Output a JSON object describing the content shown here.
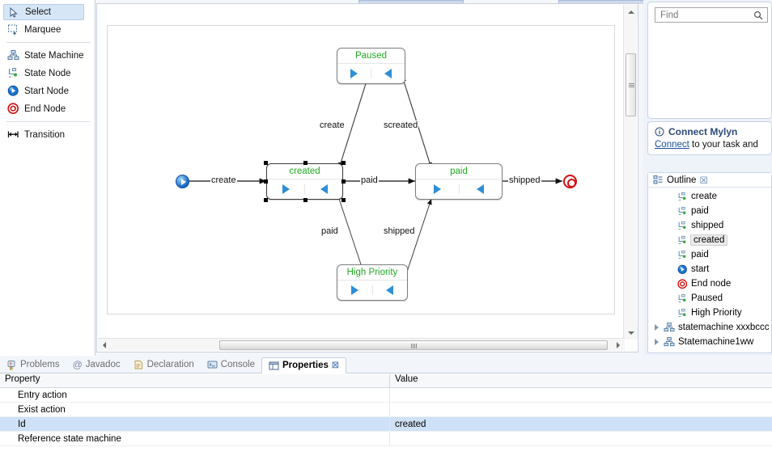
{
  "palette": {
    "groups": [
      {
        "items": [
          {
            "label": "Select",
            "icon": "cursor-icon",
            "selected": true
          },
          {
            "label": "Marquee",
            "icon": "marquee-icon",
            "selected": false
          }
        ]
      },
      {
        "items": [
          {
            "label": "State Machine",
            "icon": "state-machine-icon",
            "selected": false
          },
          {
            "label": "State Node",
            "icon": "state-node-icon",
            "selected": false
          },
          {
            "label": "Start Node",
            "icon": "start-node-icon",
            "selected": false
          },
          {
            "label": "End Node",
            "icon": "end-node-icon",
            "selected": false
          }
        ]
      },
      {
        "items": [
          {
            "label": "Transition",
            "icon": "transition-icon",
            "selected": false
          }
        ]
      }
    ]
  },
  "diagram": {
    "nodes": [
      {
        "id": "paused",
        "label": "Paused",
        "selected": false
      },
      {
        "id": "created",
        "label": "created",
        "selected": true
      },
      {
        "id": "paid",
        "label": "paid",
        "selected": false
      },
      {
        "id": "high_priority",
        "label": "High Priority",
        "selected": false
      }
    ],
    "start_node": "start-node-icon",
    "end_node": "end-node-icon",
    "edge_labels": {
      "start_to_created": "create",
      "created_to_paused": "create",
      "paused_to_paid": "screated",
      "created_to_paid": "paid",
      "paid_to_end": "shipped",
      "created_to_high": "paid",
      "high_to_paid": "shipped"
    }
  },
  "find": {
    "placeholder": "Find",
    "value": "",
    "icon": "search-icon"
  },
  "mylyn": {
    "icon": "info-icon",
    "title": "Connect Mylyn",
    "link_text": "Connect",
    "rest_text": " to your task and"
  },
  "outline": {
    "tab_label": "Outline",
    "tab_icon": "outline-icon",
    "close_glyph": "☒",
    "items": [
      {
        "label": "create",
        "icon": "state-node-icon",
        "indent": 2,
        "expandable": false,
        "selected": false
      },
      {
        "label": "paid",
        "icon": "state-node-icon",
        "indent": 2,
        "expandable": false,
        "selected": false
      },
      {
        "label": "shipped",
        "icon": "state-node-icon",
        "indent": 2,
        "expandable": false,
        "selected": false
      },
      {
        "label": "created",
        "icon": "state-node-icon",
        "indent": 2,
        "expandable": false,
        "selected": true
      },
      {
        "label": "paid",
        "icon": "state-node-icon",
        "indent": 2,
        "expandable": false,
        "selected": false
      },
      {
        "label": "start",
        "icon": "start-node-icon",
        "indent": 2,
        "expandable": false,
        "selected": false
      },
      {
        "label": "End node",
        "icon": "end-node-icon",
        "indent": 2,
        "expandable": false,
        "selected": false
      },
      {
        "label": "Paused",
        "icon": "state-node-icon",
        "indent": 2,
        "expandable": false,
        "selected": false
      },
      {
        "label": "High Priority",
        "icon": "state-node-icon",
        "indent": 2,
        "expandable": false,
        "selected": false
      },
      {
        "label": "statemachine xxxbccc",
        "icon": "state-machine-icon",
        "indent": 0,
        "expandable": true,
        "selected": false
      },
      {
        "label": "Statemachine1ww",
        "icon": "state-machine-icon",
        "indent": 0,
        "expandable": true,
        "selected": false
      }
    ]
  },
  "bottom_view": {
    "tabs": [
      {
        "label": "Problems",
        "icon": "problems-icon",
        "active": false
      },
      {
        "label": "Javadoc",
        "icon": "javadoc-icon",
        "active": false
      },
      {
        "label": "Declaration",
        "icon": "declaration-icon",
        "active": false
      },
      {
        "label": "Console",
        "icon": "console-icon",
        "active": false
      },
      {
        "label": "Properties",
        "icon": "properties-icon",
        "active": true
      }
    ],
    "columns": [
      "Property",
      "Value"
    ],
    "rows": [
      {
        "property": "Entry action",
        "value": "",
        "selected": false
      },
      {
        "property": "Exist action",
        "value": "",
        "selected": false
      },
      {
        "property": "Id",
        "value": "created",
        "selected": true
      },
      {
        "property": "Reference state machine",
        "value": "",
        "selected": false
      }
    ]
  },
  "colors": {
    "node_label": "#22aa22",
    "selection": "#cfe1f6",
    "accent": "#2e8ed6",
    "end_node": "#d01010",
    "link": "#1a4fa0"
  }
}
